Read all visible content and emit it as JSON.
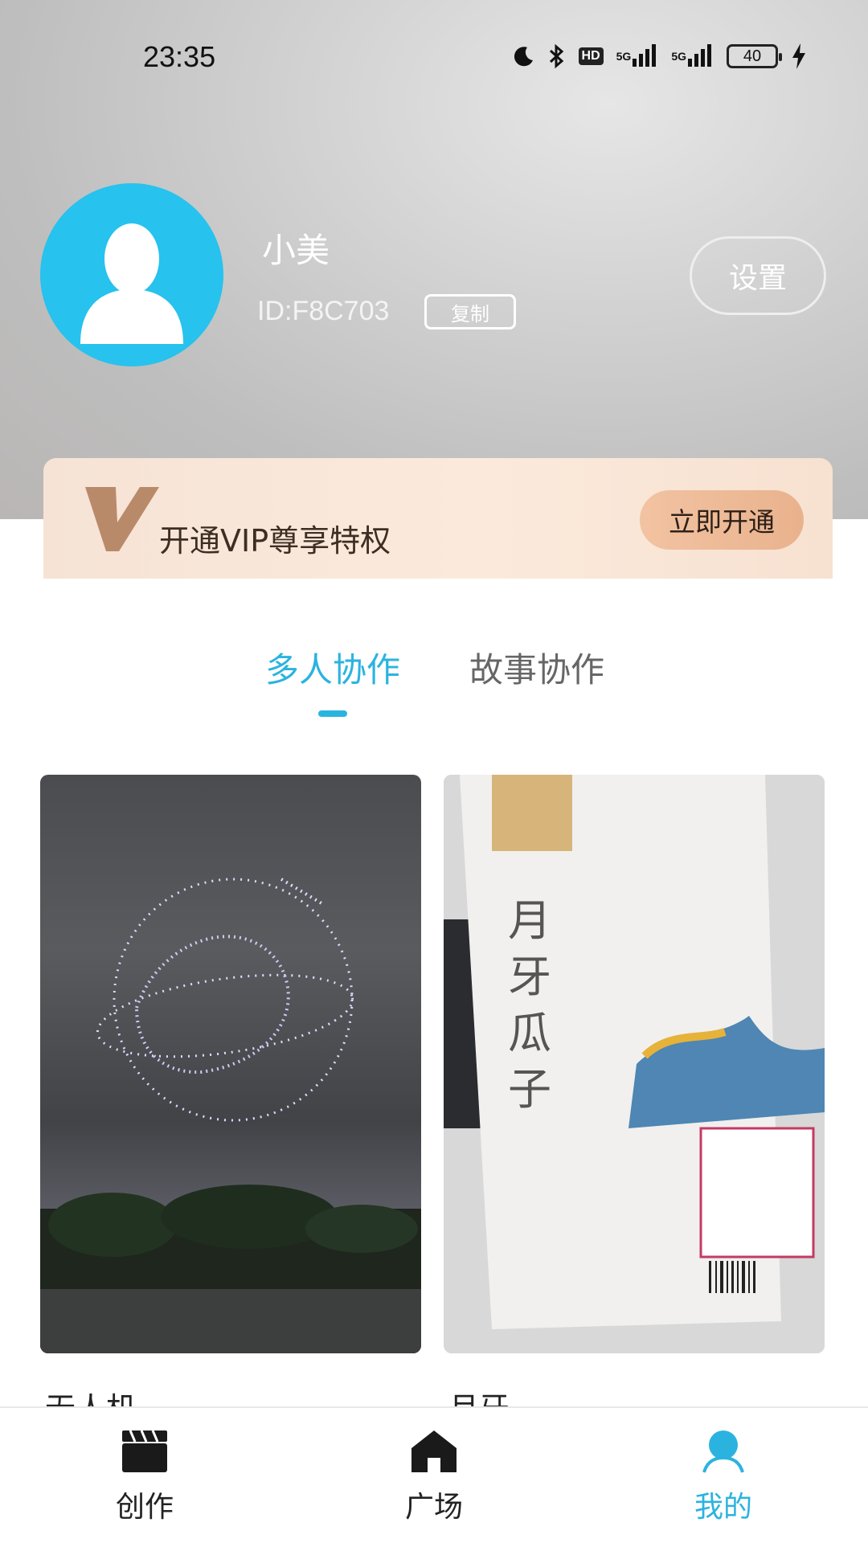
{
  "status_bar": {
    "time": "23:35",
    "icons": [
      "moon-icon",
      "bluetooth-icon",
      "hd-icon",
      "signal-5g-icon",
      "signal-5g-icon",
      "battery-icon",
      "charging-icon"
    ],
    "hd": "HD",
    "signal_1": "5G",
    "signal_2": "5G",
    "battery_level": "40"
  },
  "profile": {
    "name": "小美",
    "id": "ID:F8C703",
    "copy_label": "复制",
    "settings_label": "设置",
    "avatar_color": "#27c2ee"
  },
  "vip": {
    "text": "开通VIP尊享特权",
    "button": "立即开通"
  },
  "tabs": [
    {
      "label": "多人协作",
      "active": true
    },
    {
      "label": "故事协作",
      "active": false
    }
  ],
  "cards": [
    {
      "title": "无人机",
      "image": "night-drone-show-photo"
    },
    {
      "title": "月牙",
      "image": "snack-bag-photo"
    }
  ],
  "bottom_nav": [
    {
      "label": "创作",
      "icon": "clapperboard-icon",
      "active": false
    },
    {
      "label": "广场",
      "icon": "home-icon",
      "active": false
    },
    {
      "label": "我的",
      "icon": "user-icon",
      "active": true
    }
  ],
  "accent_color": "#2bb3e0"
}
